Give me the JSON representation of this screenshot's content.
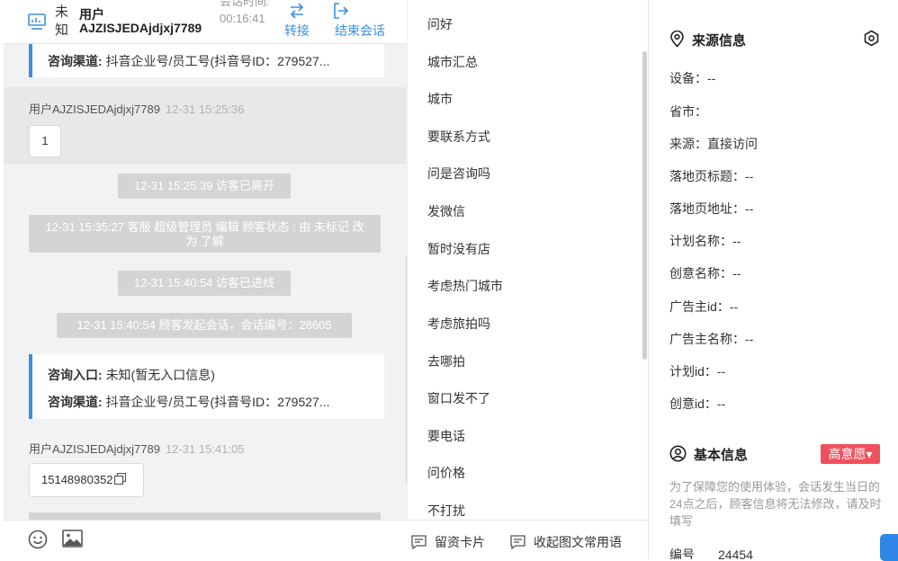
{
  "header": {
    "unknown": "未知",
    "user_label": "用户",
    "user_name": "AJZISJEDAjdjxj7789",
    "session_time_label": "会话时间:",
    "session_time": "00:16:41",
    "transfer_label": "转接",
    "end_label": "结束会话"
  },
  "chat": {
    "top_card": {
      "channel_label": "咨询渠道:",
      "channel_value": "抖音企业号/员工号(抖音号ID：279527..."
    },
    "msg1": {
      "sender": "用户AJZISJEDAjdjxj7789",
      "time": "12-31 15:25:36",
      "text": "1"
    },
    "sys1": "12-31 15:25:39 访客已离开",
    "sys2": "12-31 15:35:27 客服 超级管理员 编辑 顾客状态 : 由 未标记 改为 了解",
    "sys3": "12-31 15:40:54 访客已进线",
    "sys4": "12-31 15:40:54 顾客发起会话，会话编号：28605",
    "mid_card": {
      "entry_label": "咨询入口:",
      "entry_value": "未知(暂无入口信息)",
      "channel_label": "咨询渠道:",
      "channel_value": "抖音企业号/员工号(抖音号ID：279527..."
    },
    "msg2": {
      "sender": "用户AJZISJEDAjdjxj7789",
      "time": "12-31 15:41:05",
      "text": "15148980352"
    }
  },
  "toolbar": {
    "emoji_icon": "smile-icon",
    "image_icon": "image-icon",
    "card_label": "留资卡片",
    "collapse_label": "收起图文常用语"
  },
  "phrases": [
    "问好",
    "城市汇总",
    "城市",
    "要联系方式",
    "问是咨询吗",
    "发微信",
    "暂时没有店",
    "考虑热门城市",
    "考虑旅拍吗",
    "去哪拍",
    "窗口发不了",
    "要电话",
    "问价格",
    "不打扰"
  ],
  "source": {
    "title": "来源信息",
    "fields": [
      "设备：--",
      "省市：",
      "来源：直接访问",
      "落地页标题：--",
      "落地页地址：--",
      "计划名称：--",
      "创意名称：--",
      "广告主id：--",
      "广告主名称：--",
      "计划id：--",
      "创意id：--"
    ]
  },
  "basic": {
    "title": "基本信息",
    "intent_badge": "高意愿▾",
    "notice": "为了保障您的使用体验，会话发生当日的24点之后，顾客信息将无法修改，请及时填写",
    "serial_label": "编号",
    "serial_value": "24454"
  },
  "colors": {
    "accent": "#3c8ee0",
    "badge": "#f0505c",
    "system_msg": "#d4d4d4"
  }
}
